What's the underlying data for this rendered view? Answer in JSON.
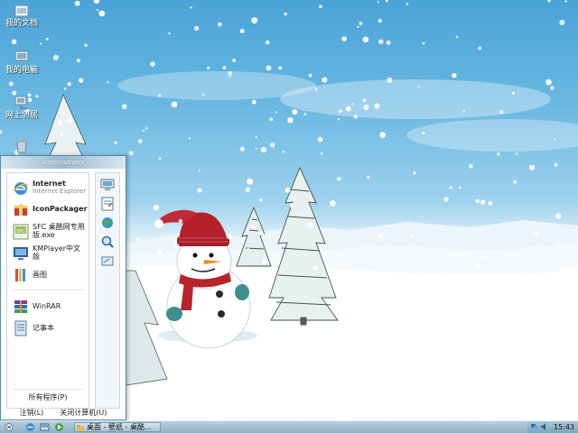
{
  "desktop": {
    "icons": [
      {
        "label": "我的文档"
      },
      {
        "label": "我的电脑"
      },
      {
        "label": "网上邻居"
      },
      {
        "label": ""
      }
    ]
  },
  "start_menu": {
    "user_name": "Administrator",
    "pinned": [
      {
        "title": "Internet",
        "subtitle": "Internet Explorer",
        "icon": "internet-explorer-icon"
      },
      {
        "title": "IconPackager",
        "subtitle": "",
        "icon": "iconpackager-icon"
      }
    ],
    "recent": [
      {
        "label": "SFC 桌酷网专用版.exe",
        "icon": "sfc-app-icon"
      },
      {
        "label": "KMPlayer中文版",
        "icon": "kmplayer-icon"
      },
      {
        "label": "画图",
        "icon": "paint-icon"
      },
      {
        "label": "WinRAR",
        "icon": "winrar-icon"
      },
      {
        "label": "记事本",
        "icon": "notepad-icon"
      }
    ],
    "all_programs": "所有程序(P)",
    "right_icons": [
      "my-computer-icon",
      "my-documents-icon",
      "network-icon",
      "search-icon",
      "run-icon"
    ],
    "logoff": "注销(L)",
    "shutdown": "关闭计算机(U)"
  },
  "taskbar": {
    "window_title": "桌面 - 壁纸 - 桌酷...",
    "clock": "15:43"
  },
  "colors": {
    "menu_border": "#5a8aa8",
    "taskbar_top": "#b8cfdd",
    "taskbar_bottom": "#8fb1c6"
  }
}
